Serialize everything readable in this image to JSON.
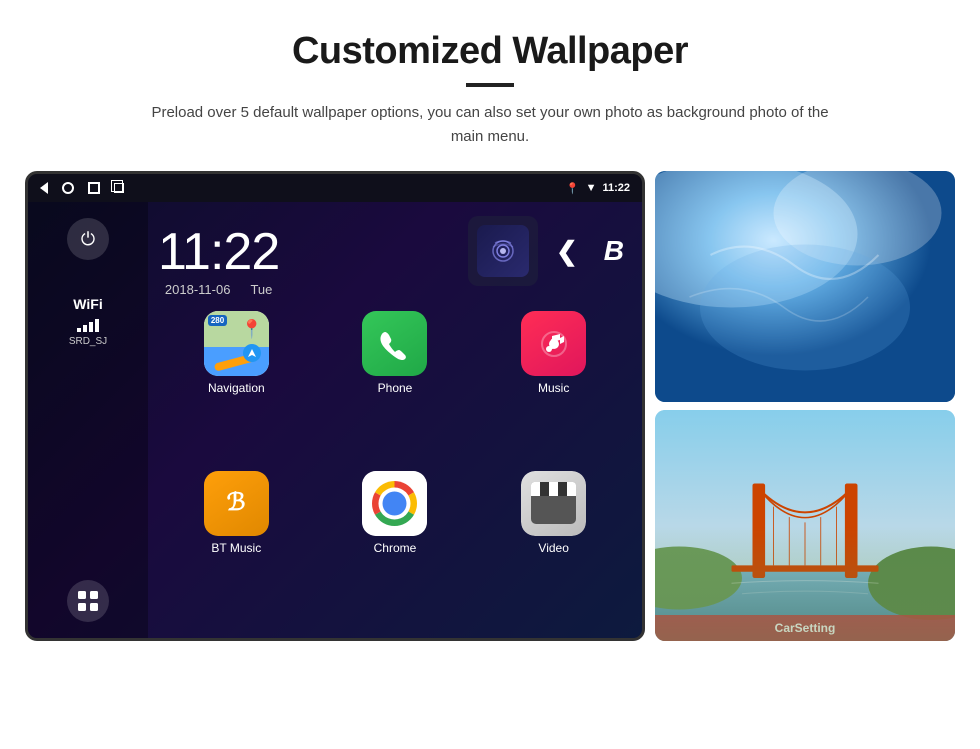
{
  "page": {
    "title": "Customized Wallpaper",
    "subtitle": "Preload over 5 default wallpaper options, you can also set your own photo as background photo of the main menu."
  },
  "device": {
    "status_bar": {
      "time": "11:22",
      "signal_icon": "wifi-signal",
      "location_icon": "location-pin"
    },
    "clock": {
      "time": "11:22",
      "date": "2018-11-06",
      "day": "Tue"
    },
    "sidebar": {
      "power_label": "⏻",
      "wifi_label": "WiFi",
      "wifi_ssid": "SRD_SJ",
      "apps_icon": "⊞"
    },
    "apps": [
      {
        "name": "Navigation",
        "type": "navigation"
      },
      {
        "name": "Phone",
        "type": "phone"
      },
      {
        "name": "Music",
        "type": "music"
      },
      {
        "name": "BT Music",
        "type": "bluetooth"
      },
      {
        "name": "Chrome",
        "type": "chrome"
      },
      {
        "name": "Video",
        "type": "video"
      }
    ],
    "carsetting": "CarSetting"
  }
}
